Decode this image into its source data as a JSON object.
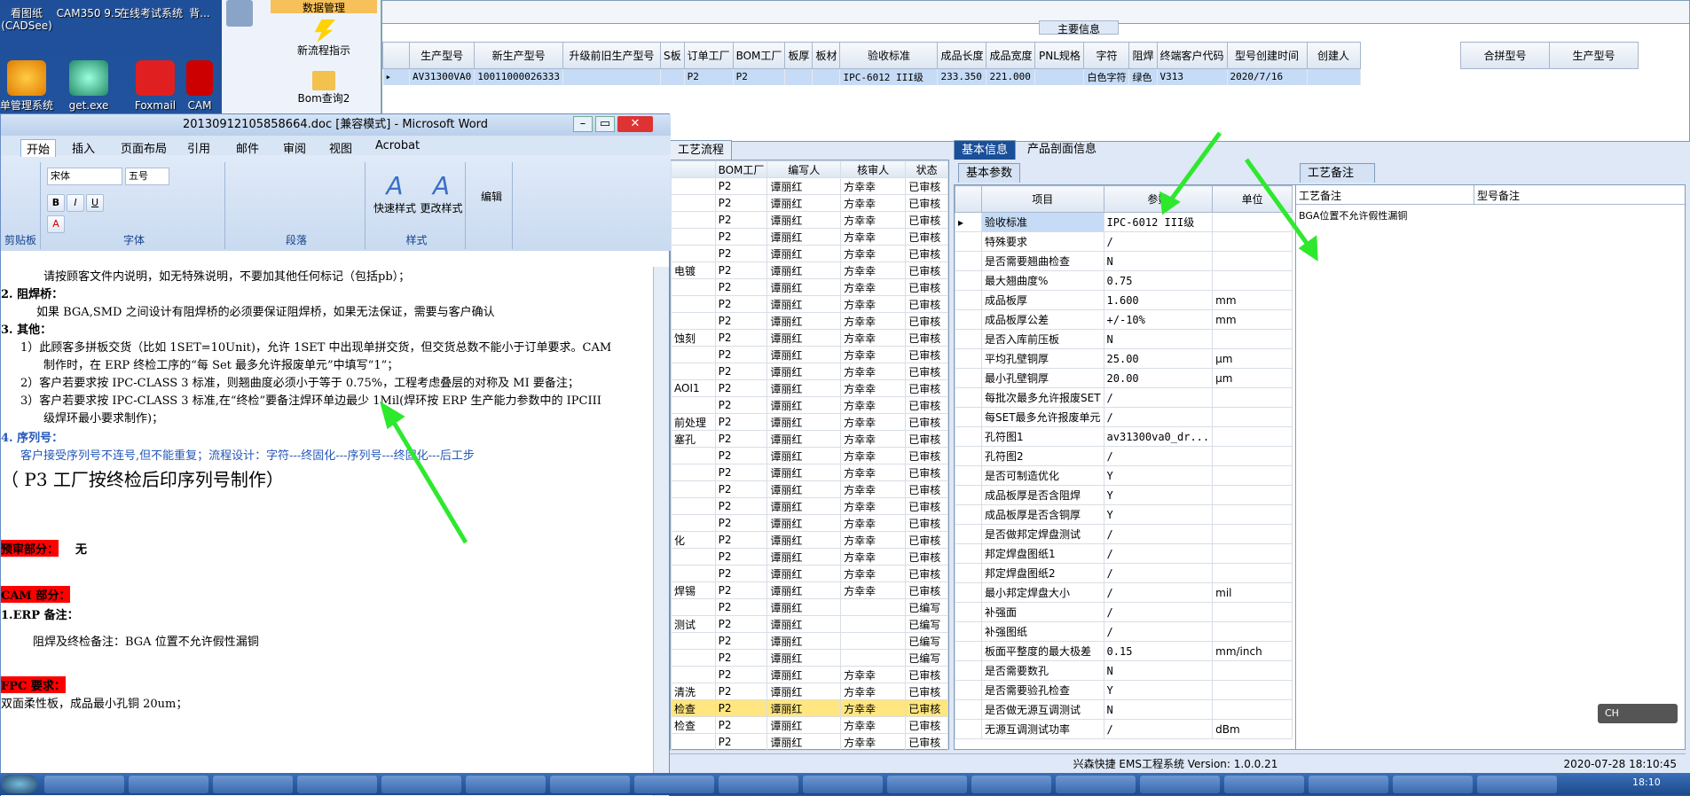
{
  "desktop": {
    "icons": [
      {
        "label": "看图纸 (CADSee)"
      },
      {
        "label": "CAM350 9.5"
      },
      {
        "label": "在线考试系统"
      },
      {
        "label": "背..."
      },
      {
        "label": "单管理系统"
      },
      {
        "label": "get.exe"
      },
      {
        "label": "Foxmail"
      },
      {
        "label": "CAM"
      }
    ]
  },
  "erp": {
    "nav": {
      "top": "数据管理",
      "new_flow": "新流程指示",
      "bom_query": "Bom查询2",
      "faded": "流程指示"
    },
    "main_info_label": "主要信息",
    "columns": [
      "生产型号",
      "新生产型号",
      "升级前旧生产型号",
      "S板",
      "订单工厂",
      "BOM工厂",
      "板厚",
      "板材",
      "验收标准",
      "成品长度",
      "成品宽度",
      "PNL规格",
      "字符",
      "阻焊",
      "终端客户代码",
      "型号创建时间",
      "创建人"
    ],
    "row": [
      "AV31300VA0",
      "10011000026333",
      "",
      "",
      "P2",
      "P2",
      "",
      "",
      "IPC-6012 III级",
      "233.350",
      "221.000",
      "",
      "白色字符",
      "绿色",
      "V313",
      "2020/7/16",
      ""
    ],
    "right_cols": [
      "合拼型号",
      "生产型号"
    ],
    "proc_tab": "工艺流程",
    "proc_cols": [
      "BOM工厂",
      "编写人",
      "核审人",
      "状态"
    ],
    "proc_rows": [
      [
        "P2",
        "谭丽红",
        "方幸幸",
        "已审核"
      ],
      [
        "P2",
        "谭丽红",
        "方幸幸",
        "已审核"
      ],
      [
        "P2",
        "谭丽红",
        "方幸幸",
        "已审核"
      ],
      [
        "P2",
        "谭丽红",
        "方幸幸",
        "已审核"
      ],
      [
        "P2",
        "谭丽红",
        "方幸幸",
        "已审核"
      ],
      [
        "P2",
        "谭丽红",
        "方幸幸",
        "已审核"
      ],
      [
        "P2",
        "谭丽红",
        "方幸幸",
        "已审核"
      ],
      [
        "P2",
        "谭丽红",
        "方幸幸",
        "已审核"
      ],
      [
        "P2",
        "谭丽红",
        "方幸幸",
        "已审核"
      ],
      [
        "P2",
        "谭丽红",
        "方幸幸",
        "已审核"
      ],
      [
        "P2",
        "谭丽红",
        "方幸幸",
        "已审核"
      ],
      [
        "P2",
        "谭丽红",
        "方幸幸",
        "已审核"
      ],
      [
        "P2",
        "谭丽红",
        "方幸幸",
        "已审核"
      ],
      [
        "P2",
        "谭丽红",
        "方幸幸",
        "已审核"
      ],
      [
        "P2",
        "谭丽红",
        "方幸幸",
        "已审核"
      ],
      [
        "P2",
        "谭丽红",
        "方幸幸",
        "已审核"
      ],
      [
        "P2",
        "谭丽红",
        "方幸幸",
        "已审核"
      ],
      [
        "P2",
        "谭丽红",
        "方幸幸",
        "已审核"
      ],
      [
        "P2",
        "谭丽红",
        "方幸幸",
        "已审核"
      ],
      [
        "P2",
        "谭丽红",
        "方幸幸",
        "已审核"
      ],
      [
        "P2",
        "谭丽红",
        "方幸幸",
        "已审核"
      ],
      [
        "P2",
        "谭丽红",
        "方幸幸",
        "已审核"
      ],
      [
        "P2",
        "谭丽红",
        "方幸幸",
        "已审核"
      ],
      [
        "P2",
        "谭丽红",
        "方幸幸",
        "已审核"
      ],
      [
        "P2",
        "谭丽红",
        "方幸幸",
        "已审核"
      ],
      [
        "P2",
        "谭丽红",
        "",
        "已编写"
      ],
      [
        "P2",
        "谭丽红",
        "",
        "已编写"
      ],
      [
        "P2",
        "谭丽红",
        "",
        "已编写"
      ],
      [
        "P2",
        "谭丽红",
        "",
        "已编写"
      ],
      [
        "P2",
        "谭丽红",
        "方幸幸",
        "已审核"
      ],
      [
        "P2",
        "谭丽红",
        "方幸幸",
        "已审核"
      ],
      [
        "P2",
        "谭丽红",
        "方幸幸",
        "已审核"
      ],
      [
        "P2",
        "谭丽红",
        "方幸幸",
        "已审核"
      ],
      [
        "P2",
        "谭丽红",
        "方幸幸",
        "已审核"
      ]
    ],
    "proc_left_labels": [
      "电镀",
      "蚀刻",
      "AOI1",
      "前处理",
      "塞孔",
      "化",
      "焊锡",
      "测试",
      "清洗",
      "检查",
      "检查"
    ],
    "base_tabs": [
      "基本信息",
      "产品剖面信息"
    ],
    "base_subtab": "基本参数",
    "base_cols": [
      "项目",
      "参数",
      "单位"
    ],
    "base_rows": [
      [
        "验收标准",
        "IPC-6012 III级",
        ""
      ],
      [
        "特殊要求",
        "/",
        ""
      ],
      [
        "是否需要翘曲检查",
        "N",
        ""
      ],
      [
        "最大翘曲度%",
        "0.75",
        ""
      ],
      [
        "成品板厚",
        "1.600",
        "mm"
      ],
      [
        "成品板厚公差",
        "+/-10%",
        "mm"
      ],
      [
        "是否入库前压板",
        "N",
        ""
      ],
      [
        "平均孔壁铜厚",
        "25.00",
        "μm"
      ],
      [
        "最小孔壁铜厚",
        "20.00",
        "μm"
      ],
      [
        "每批次最多允许报废SET",
        "/",
        ""
      ],
      [
        "每SET最多允许报废单元",
        "/",
        ""
      ],
      [
        "孔符图1",
        "av31300va0_dr...",
        ""
      ],
      [
        "孔符图2",
        "/",
        ""
      ],
      [
        "是否可制造优化",
        "Y",
        ""
      ],
      [
        "成品板厚是否含阻焊",
        "Y",
        ""
      ],
      [
        "成品板厚是否含铜厚",
        "Y",
        ""
      ],
      [
        "是否做邦定焊盘测试",
        "/",
        ""
      ],
      [
        "邦定焊盘图纸1",
        "/",
        ""
      ],
      [
        "邦定焊盘图纸2",
        "/",
        ""
      ],
      [
        "最小邦定焊盘大小",
        "/",
        "mil"
      ],
      [
        "补强面",
        "/",
        ""
      ],
      [
        "补强图纸",
        "/",
        ""
      ],
      [
        "板面平整度的最大极差",
        "0.15",
        "mm/inch"
      ],
      [
        "是否需要数孔",
        "N",
        ""
      ],
      [
        "是否需要验孔检查",
        "Y",
        ""
      ],
      [
        "是否做无源互调测试",
        "N",
        ""
      ],
      [
        "无源互调测试功率",
        "/",
        "dBm"
      ]
    ],
    "craft_tab": "工艺备注",
    "craft_cols": [
      "工艺备注",
      "型号备注"
    ],
    "craft_note": "BGA位置不允许假性漏铜",
    "status_bar": "兴森快捷 EMS工程系统 Version: 1.0.0.21",
    "status_time": "2020-07-28 18:10:45"
  },
  "word": {
    "title": "20130912105858664.doc [兼容模式] - Microsoft Word",
    "tabs": [
      "开始",
      "插入",
      "页面布局",
      "引用",
      "邮件",
      "审阅",
      "视图",
      "Acrobat"
    ],
    "font_name": "宋体",
    "font_size": "五号",
    "groups": [
      "剪贴板",
      "字体",
      "段落",
      "样式",
      "编辑"
    ],
    "quick_style": "快速样式",
    "change_style": "更改样式",
    "edit": "编辑",
    "lines": [
      "请按顾客文件内说明，如无特殊说明，不要加其他任何标记（包括pb）；",
      "2. 阻焊桥：",
      "如果 BGA,SMD 之间设计有阻焊桥的必须要保证阻焊桥，如果无法保证，需要与客户确认",
      "3. 其他：",
      "1）此顾客多拼板交货（比如 1SET=10Unit)，允许 1SET 中出现单拼交货，但交货总数不能小于订单要求。CAM",
      "制作时，在 ERP 终检工序的“每 Set 最多允许报废单元”中填写“1”；",
      "2）客户若要求按 IPC-CLASS 3 标准，则翘曲度必须小于等于 0.75%，工程考虑叠层的对称及 MI 要备注；",
      "3）客户若要求按 IPC-CLASS 3 标准,在“终检”要备注焊环单边最少 1Mil(焊环按 ERP 生产能力参数中的 IPCIII",
      "级焊环最小要求制作)；",
      "4.  序列号：",
      "客户接受序列号不连号,但不能重复；流程设计：字符---终固化---序列号---终固化---后工步",
      "（ P3 工厂按终检后印序列号制作）",
      "预审部分：",
      "无",
      "CAM 部分：",
      "1.ERP 备注：",
      "阻焊及终检备注：BGA 位置不允许假性漏铜",
      "FPC 要求：",
      "双面柔性板，成品最小孔铜 20um；"
    ]
  },
  "tray": {
    "ime": "CH",
    "clock": "18:10"
  },
  "colors": {
    "arrow": "#2ee82e",
    "highlight": "#ff0000",
    "selected": "#c6dbf5",
    "yellow_row": "#ffe680"
  }
}
